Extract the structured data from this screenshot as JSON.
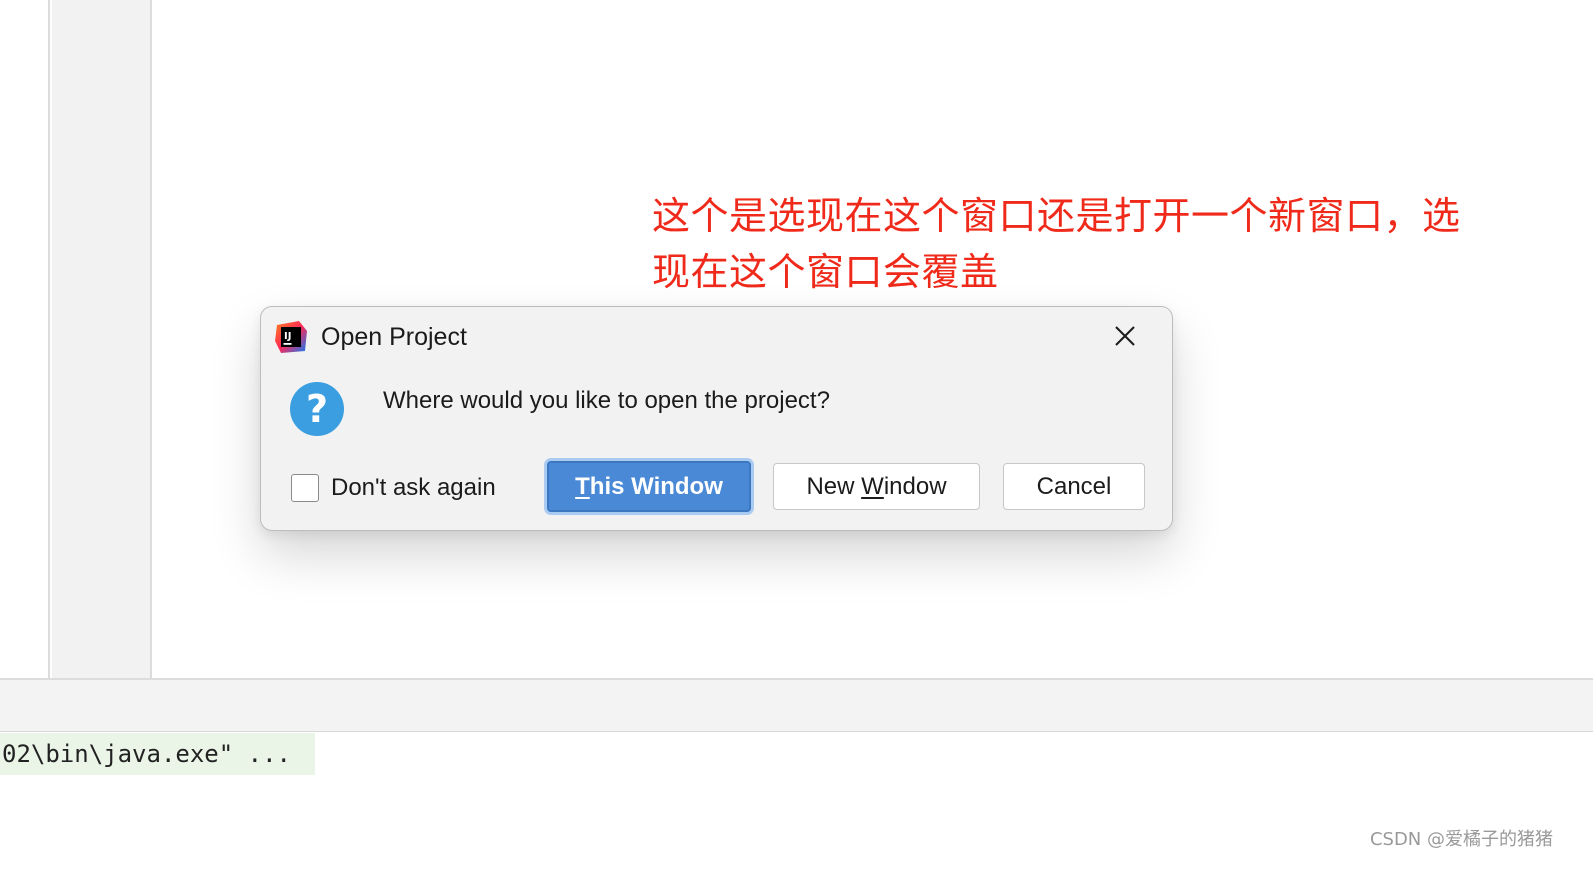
{
  "annotation": {
    "line1": "这个是选现在这个窗口还是打开一个新窗口，选",
    "line2": "现在这个窗口会覆盖",
    "color": "#f02a1a"
  },
  "dialog": {
    "title": "Open Project",
    "app_icon": "intellij-idea-icon",
    "close_icon": "close-icon",
    "question_icon": "question-icon",
    "message": "Where would you like to open the project?",
    "checkbox_label": "Don't ask again",
    "checkbox_checked": false,
    "buttons": {
      "this_window": {
        "pre": "",
        "mnemonic": "T",
        "post": "his Window"
      },
      "new_window": {
        "pre": "New ",
        "mnemonic": "W",
        "post": "indow"
      },
      "cancel": "Cancel"
    },
    "accent_color": "#4a89d6"
  },
  "console": {
    "line": "02\\bin\\java.exe\" ..."
  },
  "watermark": "CSDN @爱橘子的猪猪"
}
